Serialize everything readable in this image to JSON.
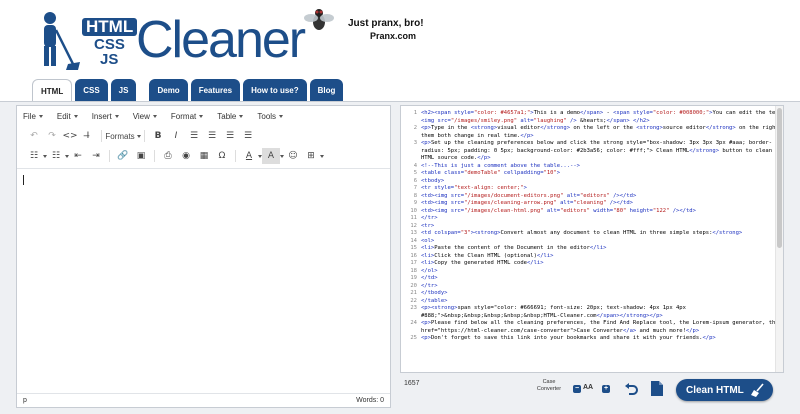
{
  "logo": {
    "html": "HTML",
    "css": "CSS",
    "js": "JS",
    "word": "Cleaner"
  },
  "promo": {
    "title": "Just pranx, bro!",
    "site": "Pranx.com"
  },
  "tabs": [
    {
      "label": "HTML",
      "active": true
    },
    {
      "label": "CSS"
    },
    {
      "label": "JS"
    },
    {
      "label": "Demo"
    },
    {
      "label": "Features"
    },
    {
      "label": "How to use?"
    },
    {
      "label": "Blog"
    }
  ],
  "editor": {
    "menus": [
      "File",
      "Edit",
      "Insert",
      "View",
      "Format",
      "Table",
      "Tools"
    ],
    "formats_label": "Formats",
    "status_path": "p",
    "words": "Words: 0"
  },
  "code_lines": [
    {
      "n": "1",
      "t": "<h2><span style=\"color: #4657a1;\">This is a demo</span> - <span style=\"color: #008000;\">You can edit the text!"
    },
    {
      "n": "",
      "t": "<img src=\"/images/smiley.png\" alt=\"laughing\" /> &hearts;</span> </h2>"
    },
    {
      "n": "2",
      "t": "<p>Type in the <strong>visual editor</strong> on the left or the <strong>source editor</strong> on the right and see"
    },
    {
      "n": "",
      "t": "them both change in real time.</p>"
    },
    {
      "n": "3",
      "t": "<p>Set up the cleaning preferences below and click the <strong style=\"box-shadow: 3px 3px 3px #aaa; border-"
    },
    {
      "n": "",
      "t": "radius: 5px; padding: 0 5px; background-color: #2b3a56; color: #fff;\"> Clean HTML</strong> button to clean the"
    },
    {
      "n": "",
      "t": "HTML source code.</p>"
    },
    {
      "n": "4",
      "t": "<!--This is just a comment above the table...-->"
    },
    {
      "n": "5",
      "t": "<table class=\"demoTable\" cellpadding=\"10\">"
    },
    {
      "n": "6",
      "t": "<tbody>"
    },
    {
      "n": "7",
      "t": "<tr style=\"text-align: center;\">"
    },
    {
      "n": "8",
      "t": "<td><img src=\"/images/document-editors.png\" alt=\"editors\" /></td>"
    },
    {
      "n": "9",
      "t": "<td><img src=\"/images/cleaning-arrow.png\" alt=\"cleaning\" /></td>"
    },
    {
      "n": "10",
      "t": "<td><img src=\"/images/clean-html.png\" alt=\"editors\" width=\"80\" height=\"122\" /></td>"
    },
    {
      "n": "11",
      "t": "</tr>"
    },
    {
      "n": "12",
      "t": "<tr>"
    },
    {
      "n": "13",
      "t": "<td colspan=\"3\"><strong>Convert almost any document to clean HTML in three simple steps:</strong>"
    },
    {
      "n": "14",
      "t": "<ol>"
    },
    {
      "n": "15",
      "t": "<li>Paste the content of the Document in the editor</li>"
    },
    {
      "n": "16",
      "t": "<li>Click the Clean HTML (optional)</li>"
    },
    {
      "n": "17",
      "t": "<li>Copy the generated HTML code</li>"
    },
    {
      "n": "18",
      "t": "</ol>"
    },
    {
      "n": "19",
      "t": "</td>"
    },
    {
      "n": "20",
      "t": "</tr>"
    },
    {
      "n": "21",
      "t": "</tbody>"
    },
    {
      "n": "22",
      "t": "</table>"
    },
    {
      "n": "23",
      "t": "<p><strong><span style=\"color: #666691; font-size: 20px; text-shadow: 4px 1px 4px"
    },
    {
      "n": "",
      "t": "#888;\">&nbsp;&nbsp;&nbsp;&nbsp;&nbsp;HTML-Cleaner.com</span></strong></p>"
    },
    {
      "n": "24",
      "t": "<p>Please find below all the cleaning preferences, the Find And Replace tool, the Lorem-ipsum generator, the <a"
    },
    {
      "n": "",
      "t": "href=\"https://html-cleaner.com/case-converter\">Case Converter</a> and much more!</p>"
    },
    {
      "n": "25",
      "t": "<p>Don't forget to save this link into your bookmarks and share it with your friends.</p>"
    }
  ],
  "bottom": {
    "char_count": "1657",
    "case_converter": "Case Converter",
    "font_size_glyph": "AA",
    "clean_button": "Clean HTML"
  },
  "colors": {
    "brand": "#1d4e89",
    "tag": "#1a2fbf",
    "string": "#b31a1a"
  }
}
